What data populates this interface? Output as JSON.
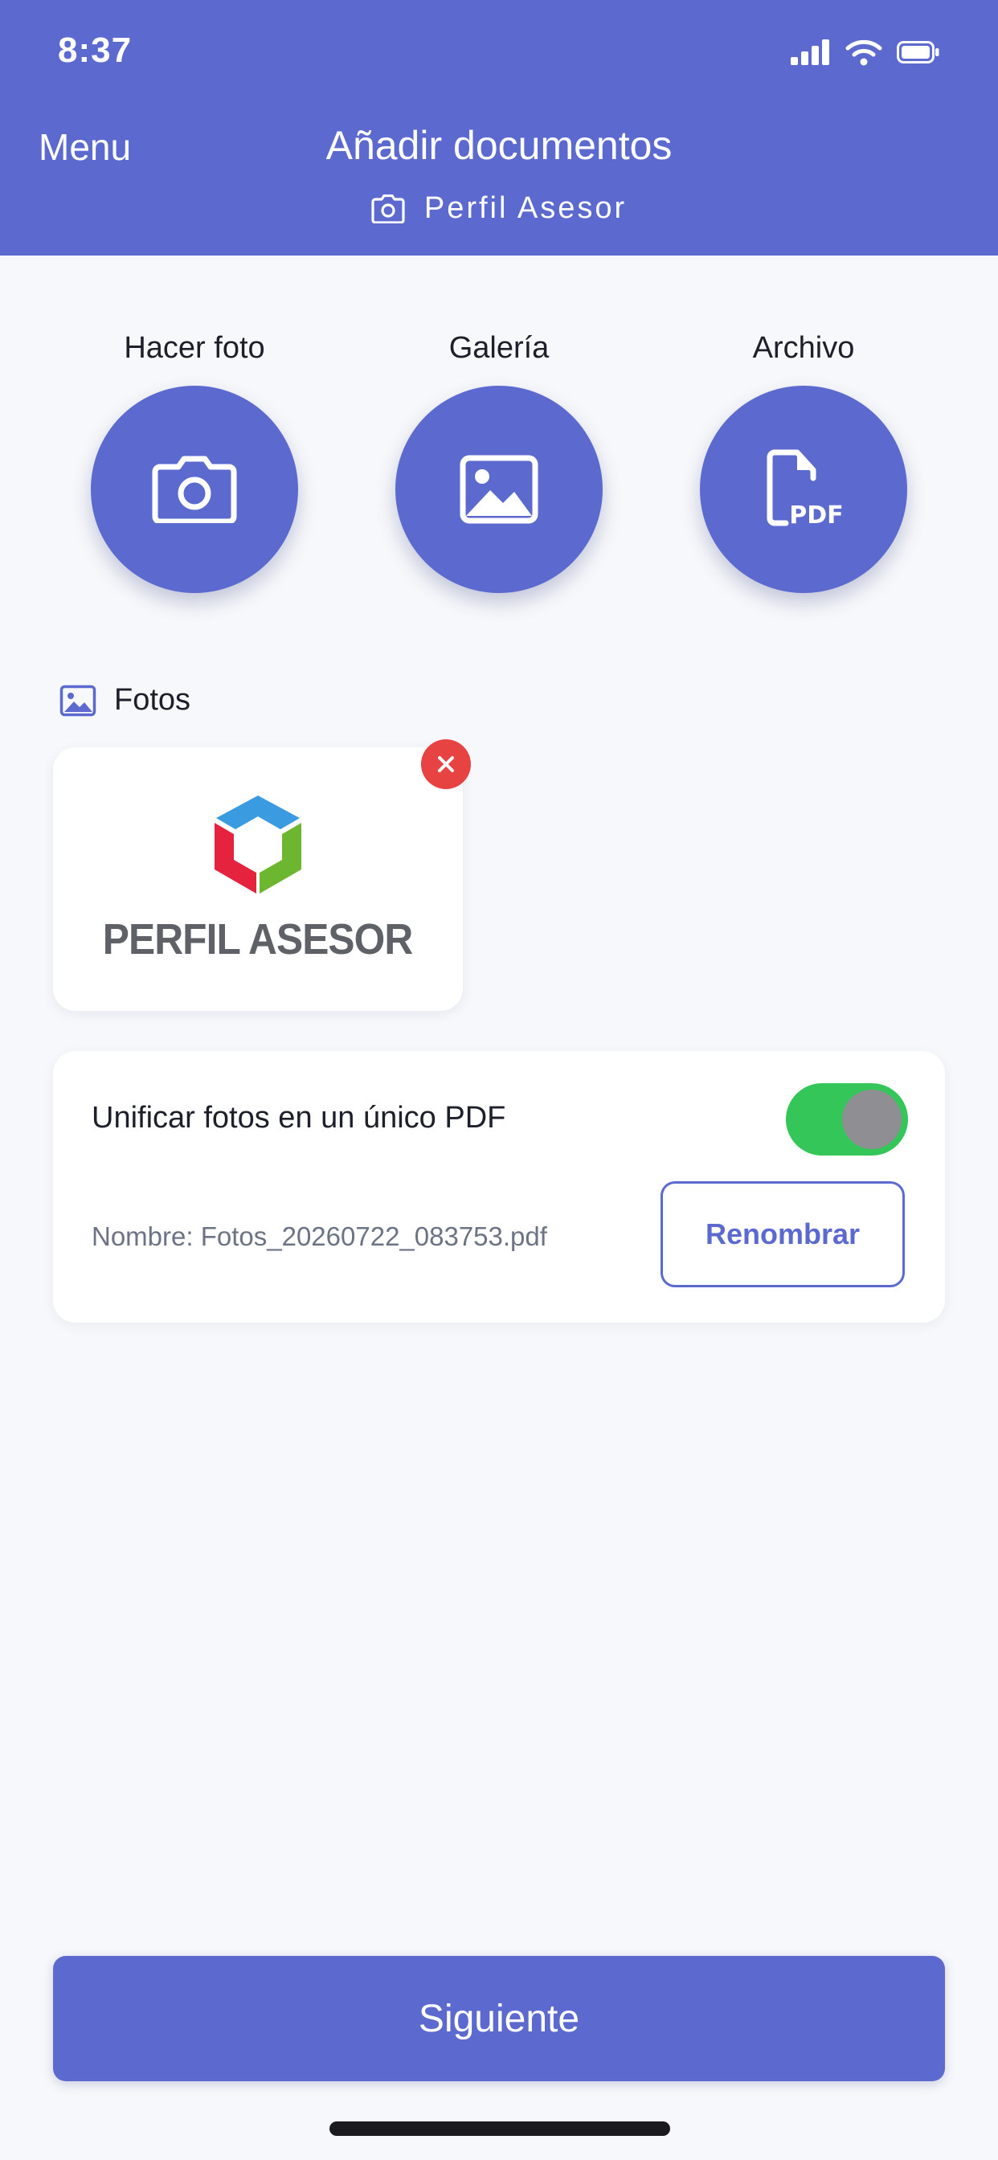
{
  "status_bar": {
    "time": "8:37",
    "icons": [
      "cellular-signal-icon",
      "wifi-icon",
      "battery-icon"
    ]
  },
  "header": {
    "menu_label": "Menu",
    "title": "Añadir documentos",
    "subtitle": "Perfil Asesor",
    "subtitle_icon": "camera-icon"
  },
  "actions": [
    {
      "label": "Hacer foto",
      "icon": "camera-icon"
    },
    {
      "label": "Galería",
      "icon": "image-icon"
    },
    {
      "label": "Archivo",
      "icon": "pdf-file-icon",
      "icon_text": "PDF"
    }
  ],
  "photos": {
    "section_title": "Fotos",
    "section_icon": "image-icon",
    "items": [
      {
        "caption": "PERFIL ASESOR",
        "remove_icon": "close-icon"
      }
    ]
  },
  "merge": {
    "label": "Unificar fotos en un único PDF",
    "enabled": true,
    "file_name": "Nombre: Fotos_20260722_083753.pdf",
    "rename_label": "Renombrar"
  },
  "footer": {
    "next_label": "Siguiente"
  },
  "colors": {
    "primary": "#5c6ad0",
    "background": "#f7f8fb",
    "toggle_on": "#35c65a",
    "remove": "#e84343",
    "logo_blue": "#3b9be0",
    "logo_red": "#e5233f",
    "logo_green": "#6cb630"
  }
}
